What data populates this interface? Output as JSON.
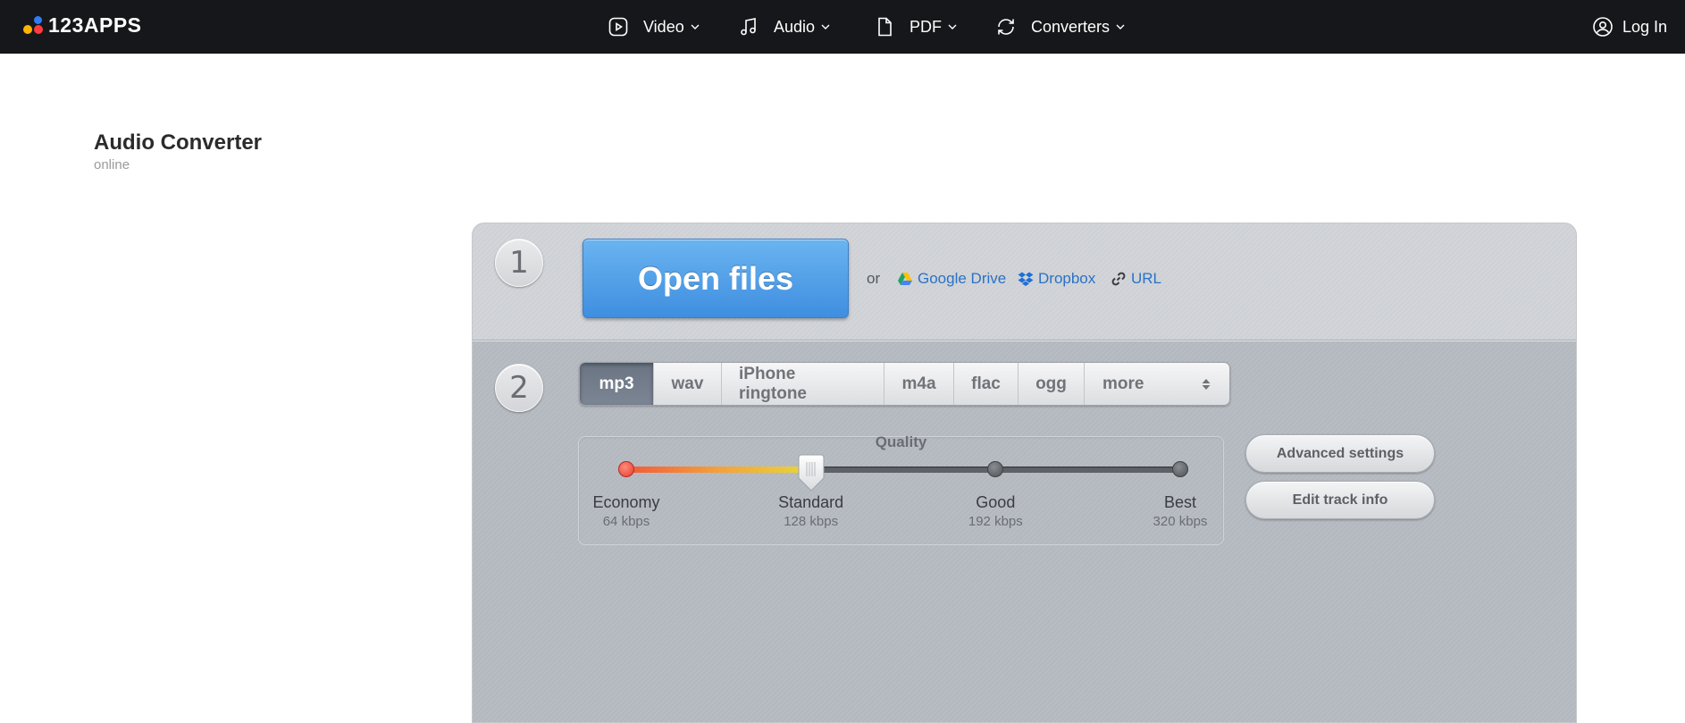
{
  "brand": {
    "name": "123APPS"
  },
  "nav": {
    "items": [
      {
        "label": "Video",
        "icon": "play-square-icon"
      },
      {
        "label": "Audio",
        "icon": "music-note-icon"
      },
      {
        "label": "PDF",
        "icon": "document-icon"
      },
      {
        "label": "Converters",
        "icon": "refresh-icon"
      }
    ],
    "login_label": "Log In"
  },
  "page": {
    "title": "Audio Converter",
    "subtitle": "online"
  },
  "step1": {
    "number": "1",
    "open_label": "Open files",
    "or_label": "or",
    "sources": [
      {
        "label": "Google Drive",
        "icon": "google-drive-icon"
      },
      {
        "label": "Dropbox",
        "icon": "dropbox-icon"
      },
      {
        "label": "URL",
        "icon": "link-icon"
      }
    ]
  },
  "step2": {
    "number": "2",
    "formats": [
      "mp3",
      "wav",
      "iPhone ringtone",
      "m4a",
      "flac",
      "ogg"
    ],
    "active_format": "mp3",
    "more_label": "more",
    "quality": {
      "title": "Quality",
      "levels": [
        {
          "name": "Economy",
          "rate": "64 kbps"
        },
        {
          "name": "Standard",
          "rate": "128 kbps"
        },
        {
          "name": "Good",
          "rate": "192 kbps"
        },
        {
          "name": "Best",
          "rate": "320 kbps"
        }
      ],
      "selected_index": 1
    },
    "advanced_label": "Advanced settings",
    "edit_track_label": "Edit track info"
  },
  "colors": {
    "accent_blue": "#3f8ee0",
    "link_blue": "#2a72c8",
    "topbar": "#16171a"
  }
}
